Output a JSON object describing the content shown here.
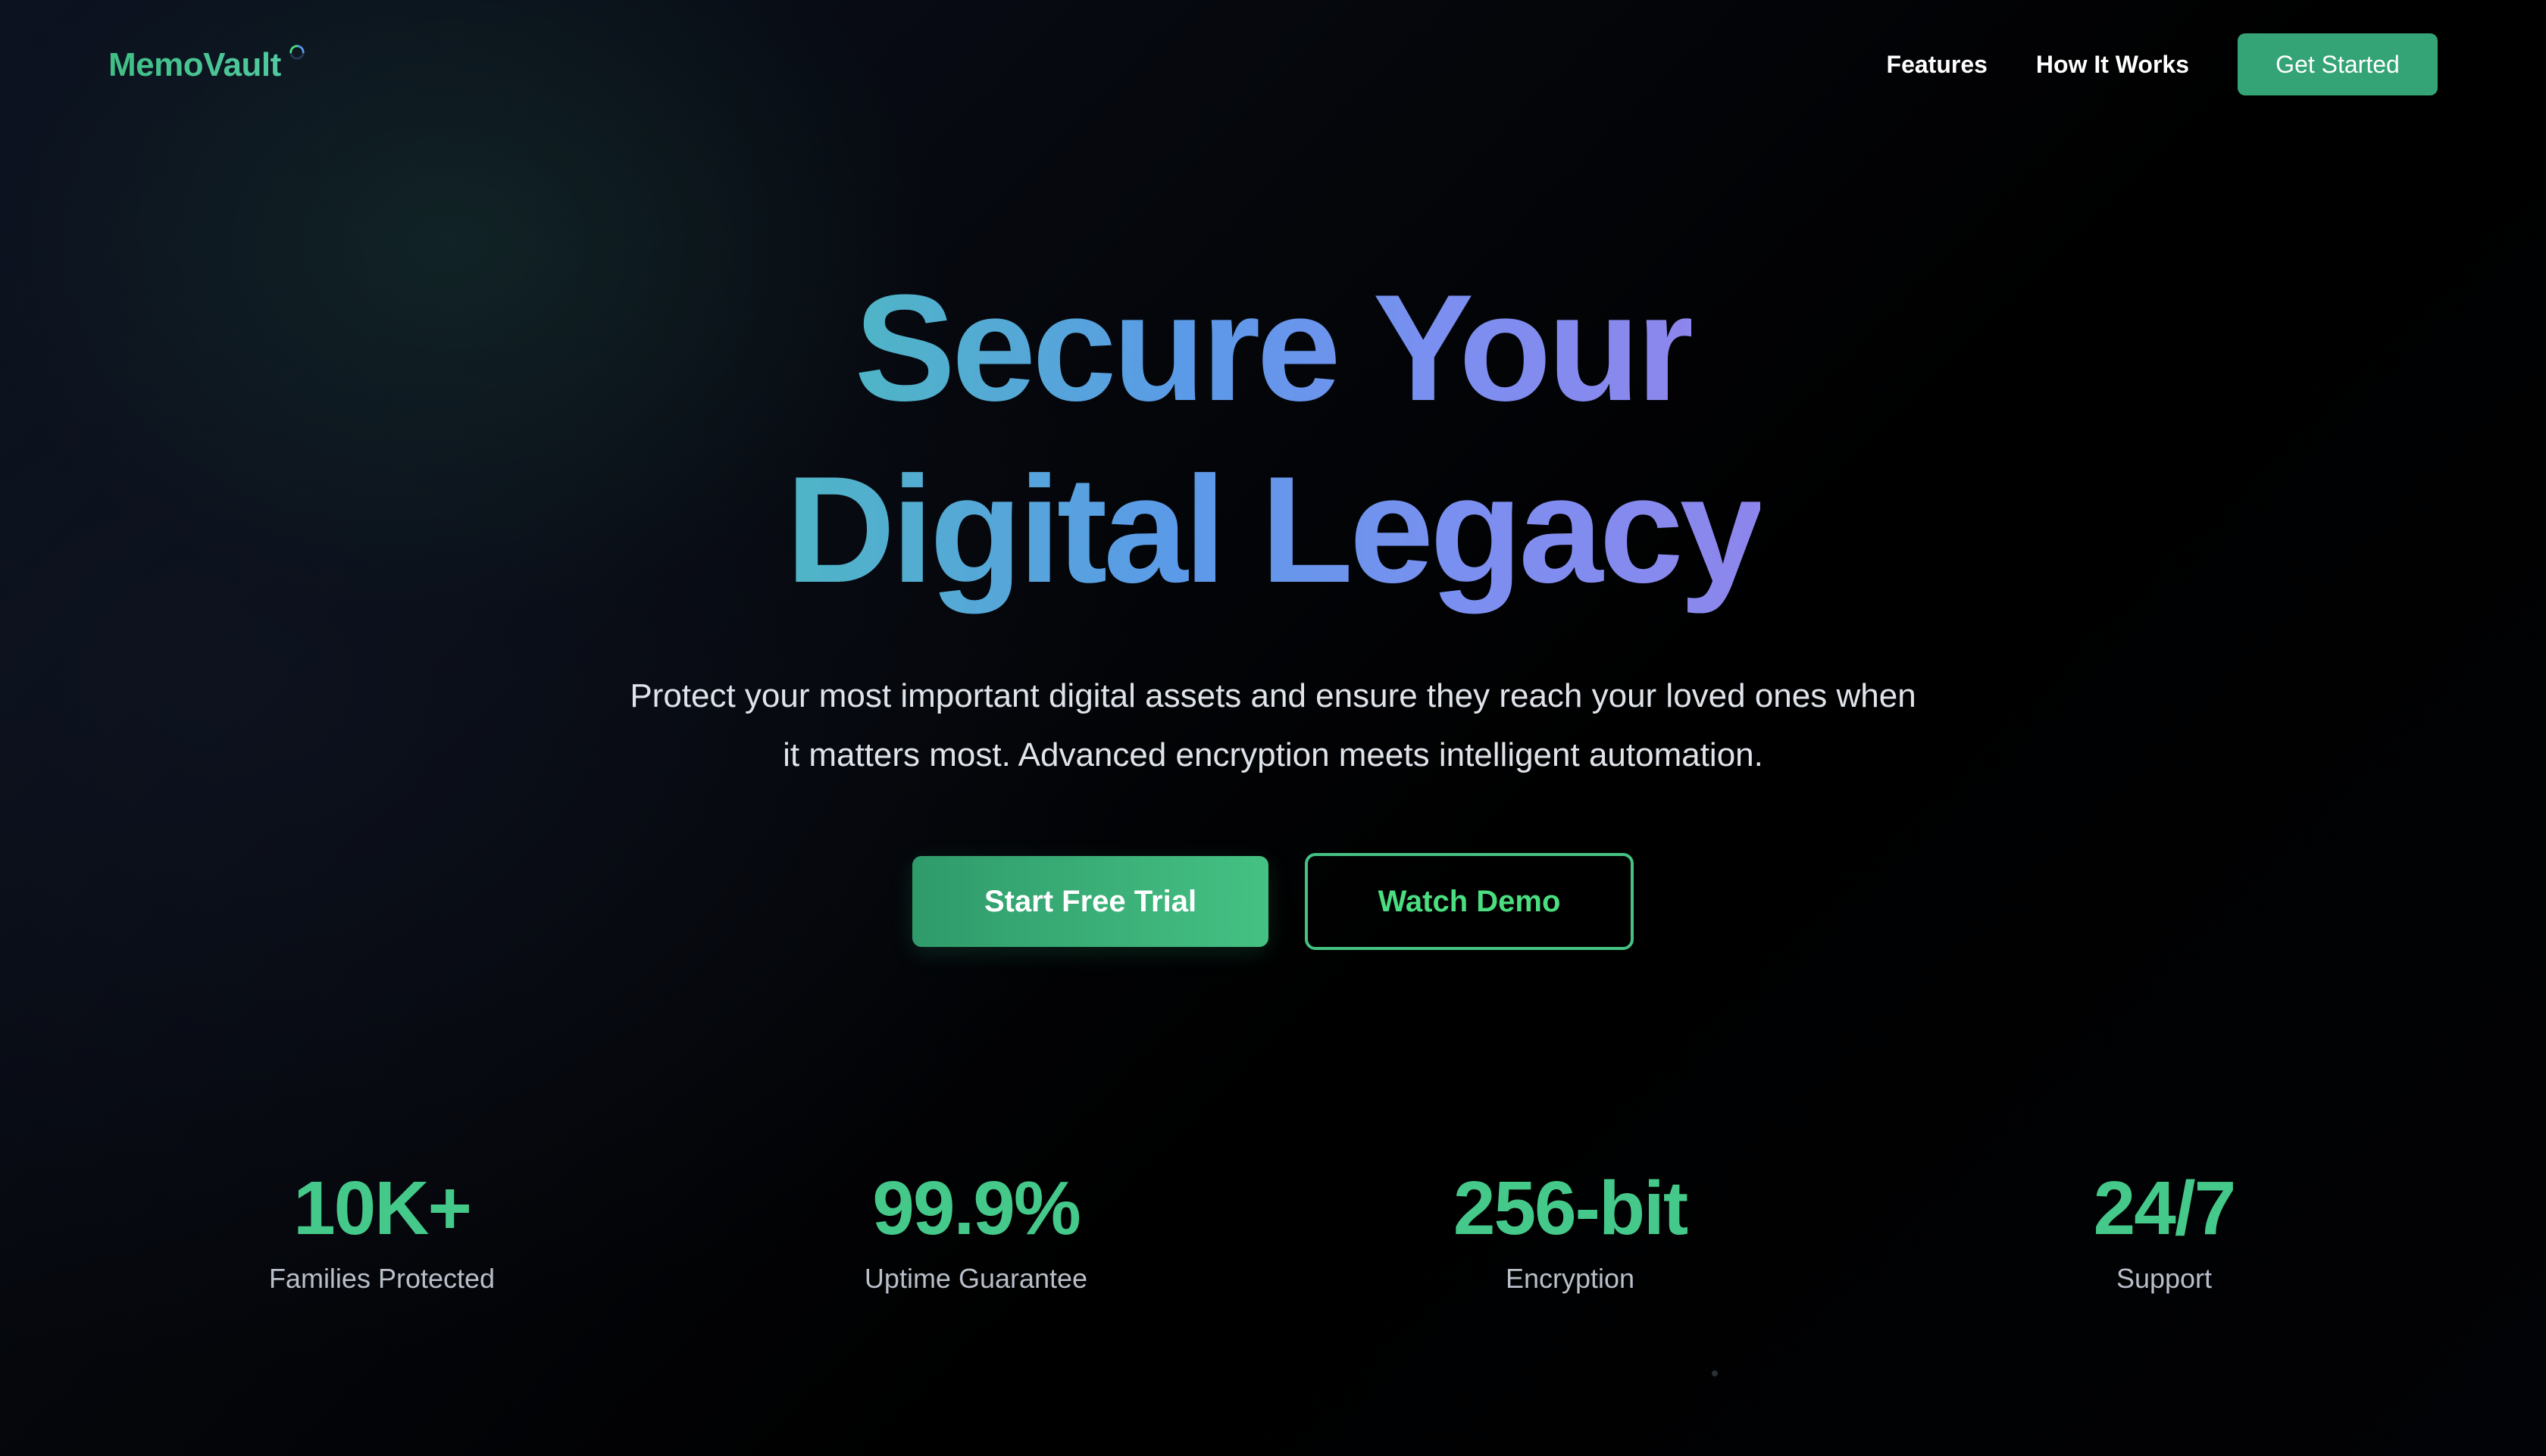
{
  "brand": {
    "name": "MemoVault",
    "accent": "#4ade80",
    "spinner_icon": "loading-ring-icon"
  },
  "nav": {
    "links": [
      "Features",
      "How It Works"
    ],
    "cta_label": "Get Started"
  },
  "hero": {
    "title_line1": "Secure Your",
    "title_line2": "Digital Legacy",
    "subtitle_line1": "Protect your most important digital assets and ensure they reach your loved ones when",
    "subtitle_line2": "it matters most. Advanced encryption meets intelligent automation.",
    "primary_cta": "Start Free Trial",
    "secondary_cta": "Watch Demo"
  },
  "stats": [
    {
      "value": "10K+",
      "label": "Families Protected"
    },
    {
      "value": "99.9%",
      "label": "Uptime Guarantee"
    },
    {
      "value": "256-bit",
      "label": "Encryption"
    },
    {
      "value": "24/7",
      "label": "Support"
    }
  ],
  "colors": {
    "background": "#000000",
    "primary_button": "#34a375",
    "title_gradient_start": "#4fb5c6",
    "title_gradient_end": "#8d86ec"
  }
}
